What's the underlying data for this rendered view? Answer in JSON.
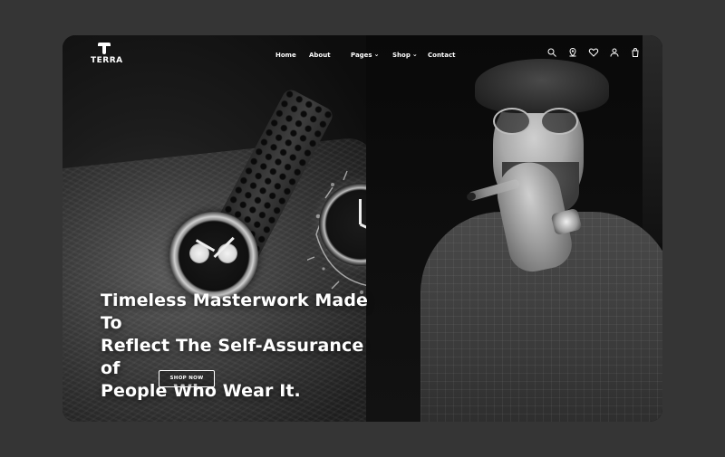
{
  "brand": {
    "name": "TERRA"
  },
  "nav": {
    "items": [
      {
        "label": "Home"
      },
      {
        "label": "About"
      },
      {
        "label": "Pages",
        "has_dropdown": true
      },
      {
        "label": "Shop",
        "has_dropdown": true
      },
      {
        "label": "Contact"
      }
    ]
  },
  "header_icons": [
    "search-icon",
    "location-icon",
    "heart-icon",
    "user-icon",
    "bag-icon"
  ],
  "hero": {
    "title_lines": [
      "Timeless Masterwork Made To",
      "Reflect The Self-Assurance of",
      "People Who Wear It."
    ],
    "cta_label": "SHOP NOW"
  },
  "colors": {
    "page_bg": "#353535",
    "frame_bg": "#0d0d0d",
    "text": "#ffffff"
  }
}
